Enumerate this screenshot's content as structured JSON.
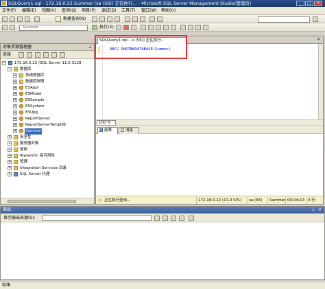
{
  "window": {
    "title": "SQLQuery1.sql - 172.16.0.22.Summer (sa (56)) 正在执行... - Microsoft SQL Server Management Studio(管理员)"
  },
  "menu": [
    "文件(F)",
    "编辑(E)",
    "视图(V)",
    "查询(Q)",
    "项目(P)",
    "调试(D)",
    "工具(T)",
    "窗口(W)",
    "帮助(H)"
  ],
  "toolbar": {
    "new_query": "新建查询(N)",
    "execute": "执行(X)",
    "database": "Summer"
  },
  "object_explorer": {
    "title": "对象资源管理器",
    "connect": "连接",
    "server": "172.16.0.22 (SQL Server 11.0.3128",
    "nodes": {
      "databases": "数据库",
      "system_databases": "系统数据库",
      "snapshots": "数据库快照",
      "db1": "ESAppl",
      "db2": "ESModel",
      "db3": "ESSample",
      "db4": "ESSystem",
      "db5": "ESUpg",
      "db6": "ReportServer",
      "db7": "ReportServerTempDB",
      "db8": "Summer",
      "security": "安全性",
      "server_objects": "服务器对象",
      "replication": "复制",
      "alwayson": "AlwaysOn 高可用性",
      "management": "管理",
      "integration": "Integration Services 目录",
      "agent": "SQL Server 代理"
    }
  },
  "editor": {
    "tab": "SQLQuery1.sql-...s (56)) 正在执行...",
    "code": "DBCC SHRINKDATABASE(Summer)",
    "zoom": "100 %"
  },
  "results_tabs": {
    "results": "结果",
    "messages": "消息"
  },
  "query_status": {
    "state": "正在执行查询...",
    "server": "172.16.0.22 (11.0 SP1)",
    "user": "sa (56)",
    "db": "Summer",
    "time": "00:04:10",
    "rows": "0 行"
  },
  "output": {
    "title": "输出",
    "source_label": "显示输出来源(S):"
  },
  "statusbar": {
    "text": "就绪"
  },
  "colors": {
    "highlight": "#e03030",
    "title_bar": "#1b3a6e",
    "query_status_bg": "#f5f1c9"
  }
}
